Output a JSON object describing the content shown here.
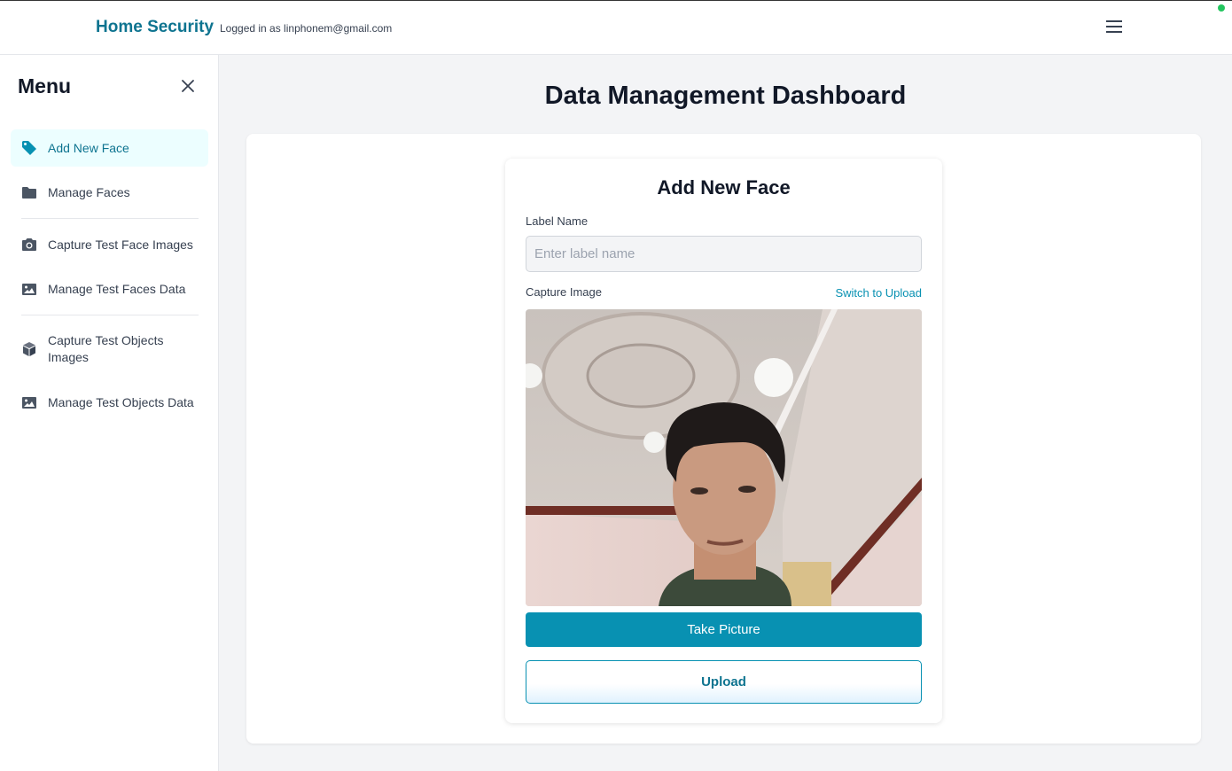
{
  "header": {
    "brand": "Home Security",
    "logged_in_text": "Logged in as linphonem@gmail.com"
  },
  "sidebar": {
    "title": "Menu",
    "items": [
      {
        "label": "Add New Face",
        "icon": "tag-icon",
        "active": true
      },
      {
        "label": "Manage Faces",
        "icon": "folder-icon",
        "active": false
      },
      {
        "label": "Capture Test Face Images",
        "icon": "camera-icon",
        "active": false
      },
      {
        "label": "Manage Test Faces Data",
        "icon": "image-icon",
        "active": false
      },
      {
        "label": "Capture Test Objects Images",
        "icon": "cube-icon",
        "active": false
      },
      {
        "label": "Manage Test Objects Data",
        "icon": "image-icon",
        "active": false
      }
    ]
  },
  "main": {
    "page_title": "Data Management Dashboard",
    "form": {
      "title": "Add New Face",
      "label_name_label": "Label Name",
      "label_name_placeholder": "Enter label name",
      "label_name_value": "",
      "capture_label": "Capture Image",
      "switch_link": "Switch to Upload",
      "take_picture": "Take Picture",
      "upload": "Upload"
    }
  },
  "colors": {
    "accent": "#0891b2",
    "brand": "#0e7490",
    "active_bg": "#ecfeff",
    "status": "#22c55e"
  }
}
